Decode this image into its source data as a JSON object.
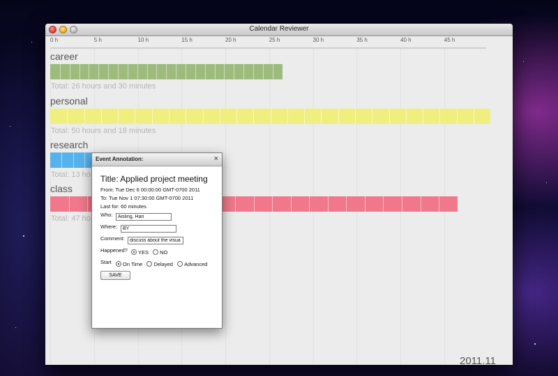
{
  "window": {
    "title": "Calendar Reviewer"
  },
  "timeline": {
    "ticks": [
      "0 h",
      "5 h",
      "10 h",
      "15 h",
      "20 h",
      "25 h",
      "30 h",
      "35 h",
      "40 h",
      "45 h"
    ],
    "categories": [
      {
        "name": "career",
        "color": "#9dbb7d",
        "hours": 26.5,
        "segment_count": 24,
        "total": "Total: 26 hours and 30 minutes"
      },
      {
        "name": "personal",
        "color": "#eeef7e",
        "hours": 50.3,
        "segment_count": 26,
        "total": "Total: 50 hours and 18 minutes"
      },
      {
        "name": "research",
        "color": "#55b2ea",
        "hours": 13.0,
        "segment_count": 10,
        "total": "Total: 13 ho"
      },
      {
        "name": "class",
        "color": "#f0788a",
        "hours": 46.5,
        "segment_count": 22,
        "total": "Total: 47 ho"
      }
    ],
    "month_label": "2011.11"
  },
  "dialog": {
    "header": "Event Annotation:",
    "close_glyph": "×",
    "event_title": "Title: Applied project meeting",
    "from": "From: Tue Dec 6 00:00:00 GMT-0700 2011",
    "to": "To: Tue Nov 1 07:30:00 GMT-0700 2011",
    "duration": "Last for: 60 minutes",
    "who_label": "Who:",
    "who_value": "Aisling, Hari",
    "where_label": "Where:",
    "where_value": "BY",
    "comment_label": "Comment:",
    "comment_value": "discuss about the visua",
    "happened_label": "Happened?",
    "happened_options": [
      "YES",
      "NO"
    ],
    "happened_selected": "YES",
    "start_label": "Start",
    "start_options": [
      "On Time",
      "Delayed",
      "Advanced"
    ],
    "start_selected": "On Time",
    "save_label": "SAVE"
  }
}
